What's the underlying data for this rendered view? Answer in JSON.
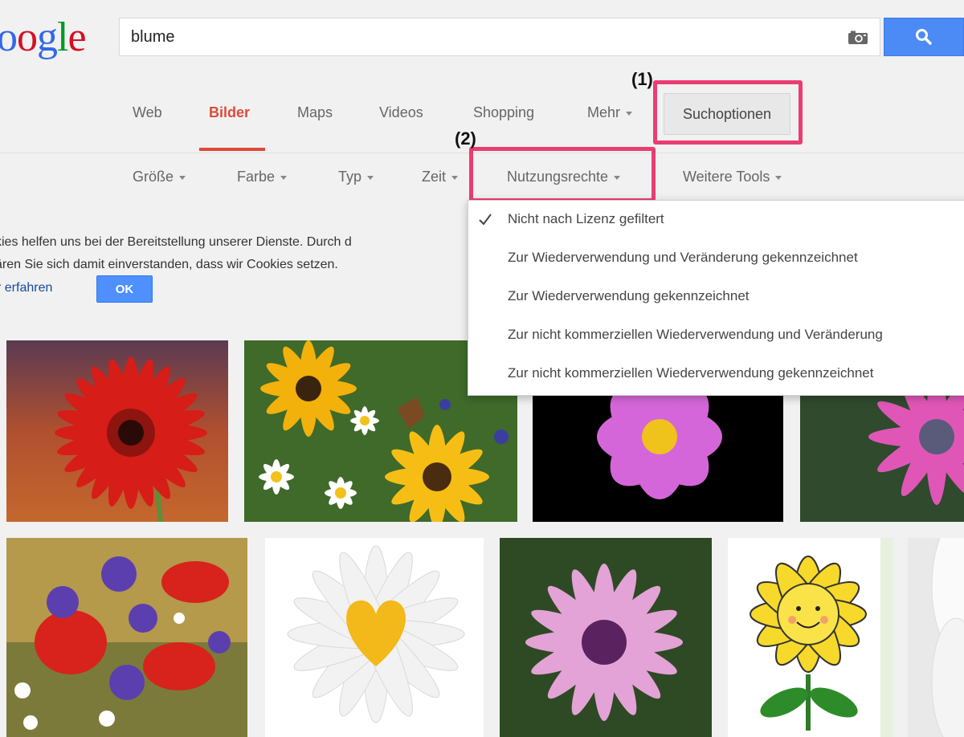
{
  "search": {
    "logo": "oogle",
    "query": "blume"
  },
  "nav": {
    "items": [
      "Web",
      "Bilder",
      "Maps",
      "Videos",
      "Shopping",
      "Mehr"
    ],
    "active": "Bilder",
    "search_options": "Suchoptionen"
  },
  "tools": {
    "items": [
      "Größe",
      "Farbe",
      "Typ",
      "Zeit",
      "Nutzungsrechte",
      "Weitere Tools"
    ]
  },
  "annotations": {
    "label_1": "(1)",
    "label_2": "(2)"
  },
  "cookie": {
    "line1": "kies helfen uns bei der Bereitstellung unserer Dienste. Durch d",
    "line2": "ären Sie sich damit einverstanden, dass wir Cookies setzen.",
    "more": "r erfahren",
    "ok": "OK"
  },
  "license_menu": {
    "options": [
      "Nicht nach Lizenz gefiltert",
      "Zur Wiederverwendung und Veränderung gekennzeichnet",
      "Zur Wiederverwendung gekennzeichnet",
      "Zur nicht kommerziellen Wiederverwendung und Veränderung",
      "Zur nicht kommerziellen Wiederverwendung gekennzeichnet"
    ],
    "selected_index": 0
  },
  "colors": {
    "accent_red": "#dd4b39",
    "search_blue": "#4c8bf5",
    "highlight_pink": "#ea3d72",
    "logo_blue": "#3369e8",
    "logo_red": "#d50f25",
    "logo_yellow": "#eeb211",
    "logo_green": "#009925"
  },
  "icons": [
    "camera-icon",
    "search-icon",
    "check-icon",
    "caret-down-icon"
  ],
  "images": [
    "red-gerbera",
    "yellow-wildflowers-with-butterfly",
    "pink-cosmos",
    "magenta-daisy",
    "poppy-cornflower-meadow",
    "white-daisy-heart-center",
    "pink-daisy",
    "cartoon-sunflower",
    "white-petals-partial"
  ]
}
